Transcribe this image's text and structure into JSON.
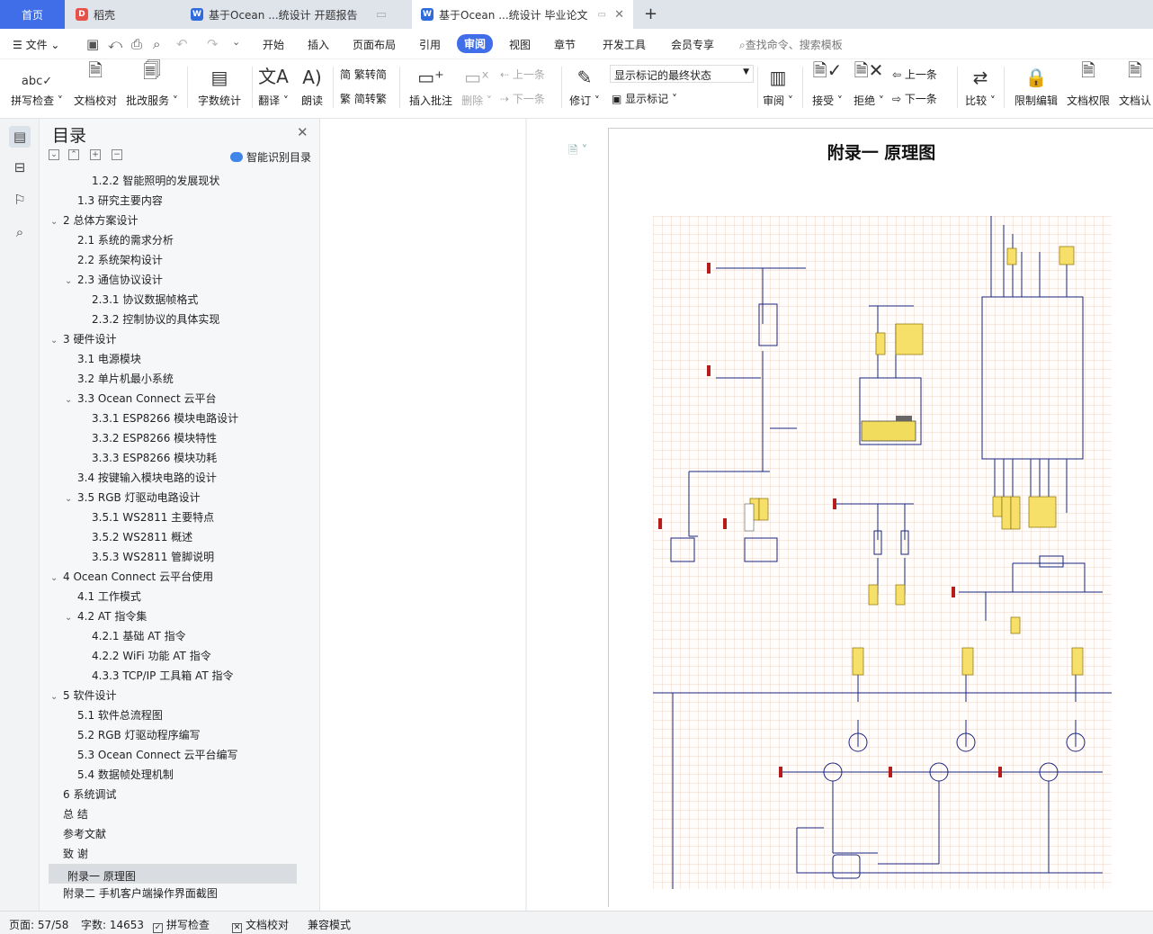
{
  "tabs": {
    "home": "首页",
    "daoke": "稻壳",
    "doc1": "基于Ocean ...统设计 开题报告",
    "doc2": "基于Ocean ...统设计 毕业论文",
    "new_tab": "+"
  },
  "menu": {
    "file": "文件",
    "items": [
      "开始",
      "插入",
      "页面布局",
      "引用",
      "审阅",
      "视图",
      "章节",
      "开发工具",
      "会员专享"
    ],
    "active": "审阅",
    "search": "查找命令、搜索模板"
  },
  "ribbon": {
    "spell_check": "拼写检查",
    "doc_proof": "文档校对",
    "batch_service": "批改服务",
    "word_count": "字数统计",
    "translate": "翻译",
    "read_aloud": "朗读",
    "trad_to_simp": "繁转简",
    "simp_to_trad": "简转繁",
    "insert_comment": "插入批注",
    "delete": "删除",
    "prev": "上一条",
    "next": "下一条",
    "revise": "修订",
    "show_markup_state": "显示标记的最终状态",
    "show_markup": "显示标记",
    "review": "审阅",
    "accept": "接受",
    "reject": "拒绝",
    "prev2": "上一条",
    "next2": "下一条",
    "compare": "比较",
    "restrict_edit": "限制编辑",
    "doc_permission": "文档权限",
    "doc_cert": "文档认"
  },
  "toc": {
    "title": "目录",
    "smart": "智能识别目录",
    "items": [
      {
        "text": "1.2.2 智能照明的发展现状",
        "level": 3,
        "caret": ""
      },
      {
        "text": "1.3  研究主要内容",
        "level": 2,
        "caret": ""
      },
      {
        "text": "2  总体方案设计",
        "level": 1,
        "caret": "v"
      },
      {
        "text": "2.1  系统的需求分析",
        "level": 2,
        "caret": ""
      },
      {
        "text": "2.2  系统架构设计",
        "level": 2,
        "caret": ""
      },
      {
        "text": "2.3  通信协议设计",
        "level": 2,
        "caret": "v"
      },
      {
        "text": "2.3.1 协议数据帧格式",
        "level": 3,
        "caret": ""
      },
      {
        "text": "2.3.2 控制协议的具体实现",
        "level": 3,
        "caret": ""
      },
      {
        "text": "3  硬件设计",
        "level": 1,
        "caret": "v"
      },
      {
        "text": "3.1  电源模块",
        "level": 2,
        "caret": ""
      },
      {
        "text": "3.2  单片机最小系统",
        "level": 2,
        "caret": ""
      },
      {
        "text": "3.3 Ocean Connect 云平台",
        "level": 2,
        "caret": "v"
      },
      {
        "text": "3.3.1 ESP8266 模块电路设计",
        "level": 3,
        "caret": ""
      },
      {
        "text": "3.3.2 ESP8266 模块特性",
        "level": 3,
        "caret": ""
      },
      {
        "text": "3.3.3 ESP8266 模块功耗",
        "level": 3,
        "caret": ""
      },
      {
        "text": "3.4  按键输入模块电路的设计",
        "level": 2,
        "caret": ""
      },
      {
        "text": "3.5 RGB  灯驱动电路设计",
        "level": 2,
        "caret": "v"
      },
      {
        "text": "3.5.1 WS2811 主要特点",
        "level": 3,
        "caret": ""
      },
      {
        "text": "3.5.2 WS2811  概述",
        "level": 3,
        "caret": ""
      },
      {
        "text": "3.5.3 WS2811  管脚说明",
        "level": 3,
        "caret": ""
      },
      {
        "text": "4 Ocean Connect 云平台使用",
        "level": 1,
        "caret": "v"
      },
      {
        "text": "4.1  工作模式",
        "level": 2,
        "caret": ""
      },
      {
        "text": "4.2 AT 指令集",
        "level": 2,
        "caret": "v"
      },
      {
        "text": "4.2.1  基础 AT 指令",
        "level": 3,
        "caret": ""
      },
      {
        "text": "4.2.2 WiFi 功能 AT 指令",
        "level": 3,
        "caret": ""
      },
      {
        "text": "4.3.3 TCP/IP 工具箱  AT 指令",
        "level": 3,
        "caret": ""
      },
      {
        "text": "5  软件设计",
        "level": 1,
        "caret": "v"
      },
      {
        "text": "5.1 软件总流程图",
        "level": 2,
        "caret": ""
      },
      {
        "text": "5.2 RGB 灯驱动程序编写",
        "level": 2,
        "caret": ""
      },
      {
        "text": "5.3 Ocean  Connect 云平台编写",
        "level": 2,
        "caret": ""
      },
      {
        "text": "5.4 数据帧处理机制",
        "level": 2,
        "caret": ""
      },
      {
        "text": "6  系统调试",
        "level": 1,
        "caret": ""
      },
      {
        "text": "总   结",
        "level": 1,
        "caret": ""
      },
      {
        "text": "参考文献",
        "level": 1,
        "caret": ""
      },
      {
        "text": "致   谢",
        "level": 1,
        "caret": ""
      },
      {
        "text": "附录一  原理图",
        "level": 1,
        "caret": "",
        "selected": true
      },
      {
        "text": "附录二  手机客户端操作界面截图",
        "level": 1,
        "caret": ""
      }
    ]
  },
  "document": {
    "heading": "附录一  原理图"
  },
  "status": {
    "page": "页面: 57/58",
    "words": "字数: 14653",
    "spell": "拼写检查",
    "proof": "文档校对",
    "compat": "兼容模式"
  },
  "colors": {
    "accent": "#3f6ee8",
    "schematic_line": "#1a237e",
    "label_fill": "#f7e06a"
  }
}
